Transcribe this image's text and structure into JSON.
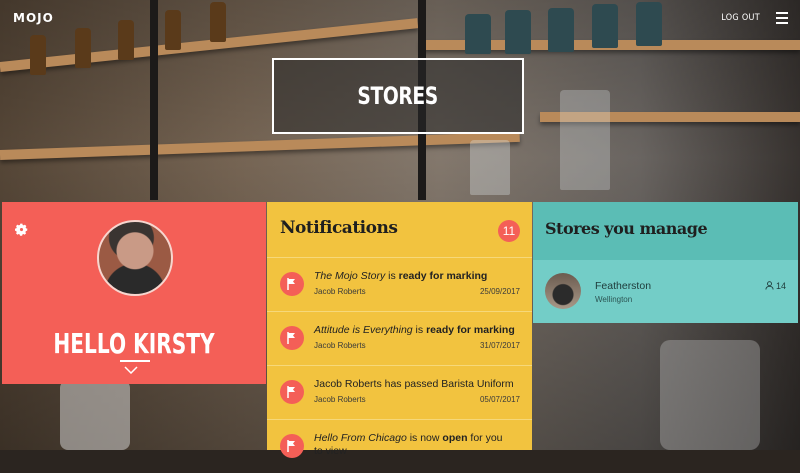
{
  "header": {
    "logo": "MOJO",
    "logout": "LOG OUT"
  },
  "title": "STORES",
  "profile": {
    "greeting": "HELLO KIRSTY"
  },
  "notifications": {
    "heading": "Notifications",
    "count": "11",
    "items": [
      {
        "title_em": "The Mojo Story",
        "mid": " is ",
        "title_b": "ready for marking",
        "tail": "",
        "name": "Jacob Roberts",
        "date": "25/09/2017"
      },
      {
        "title_em": "Attitude is Everything",
        "mid": " is ",
        "title_b": "ready for marking",
        "tail": "",
        "name": "Jacob Roberts",
        "date": "31/07/2017"
      },
      {
        "title_em": "",
        "mid": "Jacob Roberts has passed Barista Uniform",
        "title_b": "",
        "tail": "",
        "name": "Jacob Roberts",
        "date": "05/07/2017"
      },
      {
        "title_em": "Hello From Chicago",
        "mid": " is now ",
        "title_b": "open",
        "tail": " for you to view",
        "name": "",
        "date": ""
      }
    ]
  },
  "stores": {
    "heading": "Stores you manage",
    "items": [
      {
        "name": "Featherston",
        "location": "Wellington",
        "count": "14"
      }
    ]
  },
  "colors": {
    "red": "#f45f57",
    "yellow": "#f2c33f",
    "teal": "#5bbdb5"
  }
}
